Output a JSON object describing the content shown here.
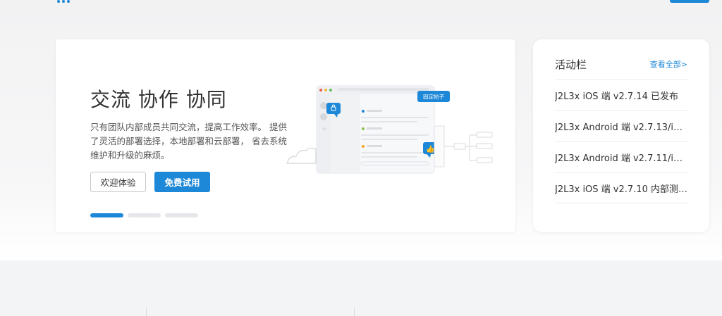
{
  "colors": {
    "accent": "#1e88d8",
    "page_bg": "#f3f4f6",
    "card_bg": "#ffffff"
  },
  "banner": {
    "title": "交流 协作 协同",
    "description": "只有团队内部成员共同交流，提高工作效率。 提供了灵活的部署选择，本地部署和云部署， 省去系统维护和升级的麻烦。",
    "btn_experience": "欢迎体验",
    "btn_trial": "免费试用",
    "illustration_tag": "固定帖子",
    "slides_total": 3,
    "slides_active": 1
  },
  "activity": {
    "title": "活动栏",
    "view_all": "查看全部>",
    "items": [
      "J2L3x iOS 端 v2.7.14 已发布",
      "J2L3x Android 端 v2.7.13/i…",
      "J2L3x Android 端 v2.7.11/i…",
      "J2L3x iOS 端 v2.7.10 内部测…"
    ]
  }
}
